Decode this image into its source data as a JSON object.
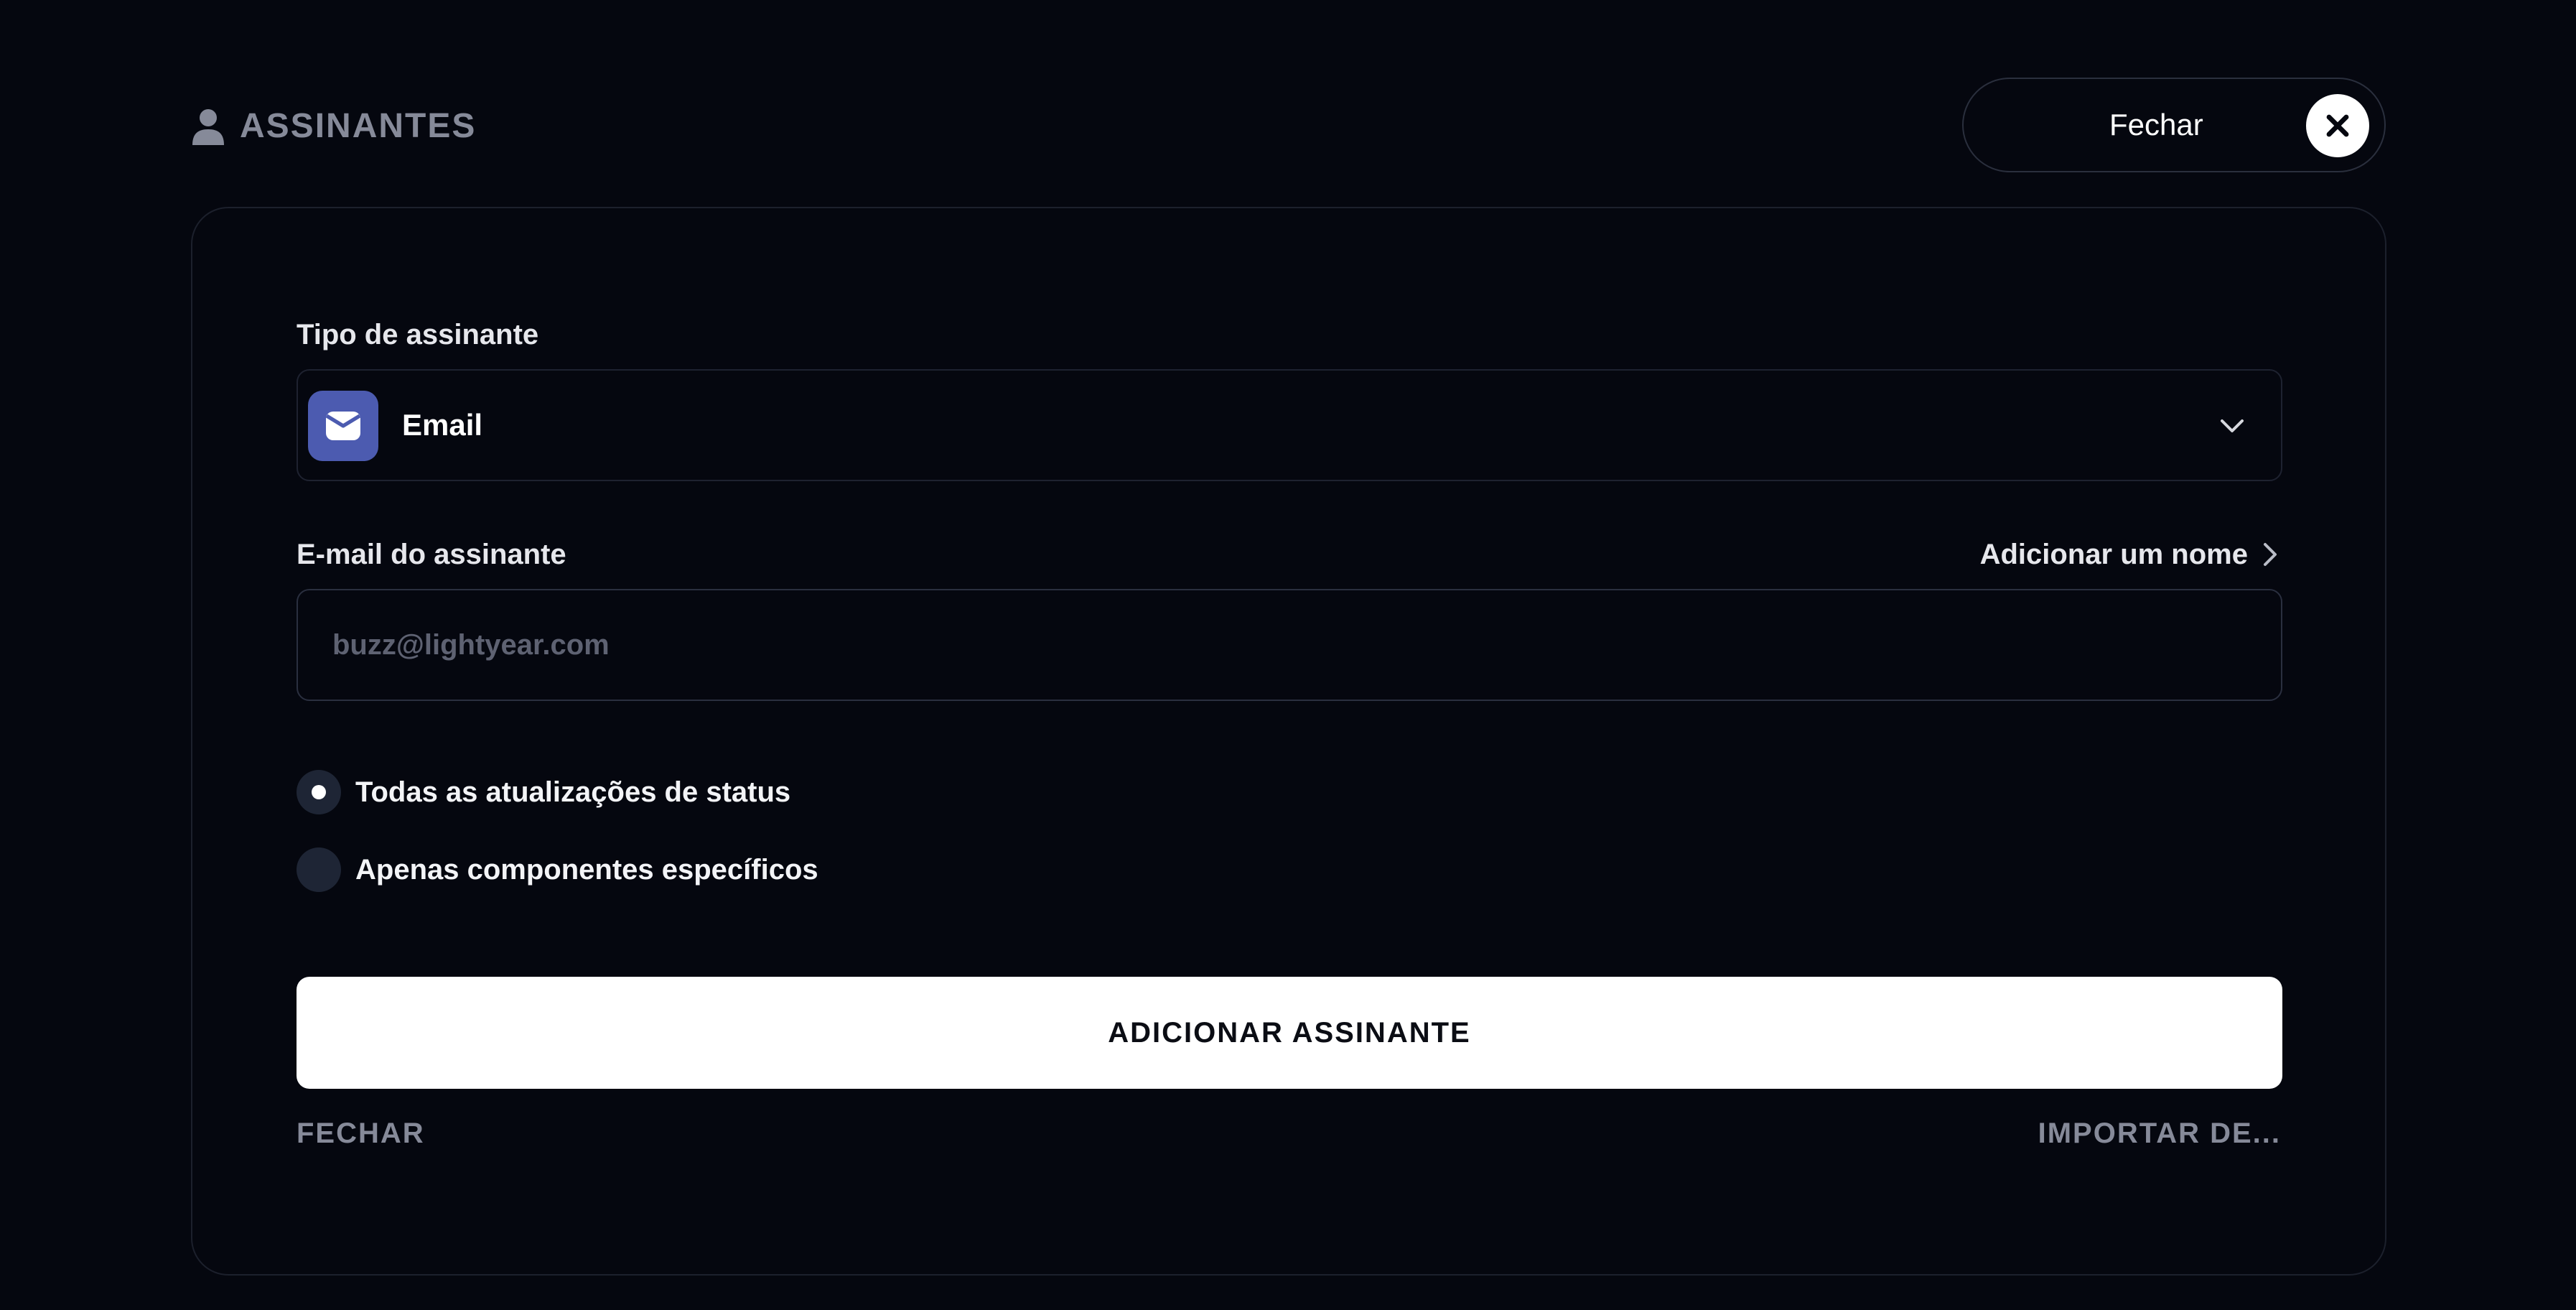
{
  "header": {
    "title": "ASSINANTES",
    "icon": "person-icon",
    "close_label": "Fechar",
    "close_icon": "close-icon"
  },
  "form": {
    "type_label": "Tipo de assinante",
    "type_value": "Email",
    "type_icon": "envelope-icon",
    "email_label": "E-mail do assinante",
    "add_name_label": "Adicionar um nome",
    "email_placeholder": "buzz@lightyear.com",
    "email_value": "",
    "radio_options": [
      {
        "label": "Todas as atualizações de status",
        "selected": true
      },
      {
        "label": "Apenas componentes específicos",
        "selected": false
      }
    ],
    "submit_label": "ADICIONAR ASSINANTE",
    "close_label": "FECHAR",
    "import_label": "IMPORTAR DE..."
  },
  "colors": {
    "background": "#05070f",
    "card_border": "#1c202c",
    "muted_text": "#868a99",
    "email_badge": "#4c5bb0",
    "radio_fill": "#1e2535",
    "primary_button": "#ffffff"
  }
}
